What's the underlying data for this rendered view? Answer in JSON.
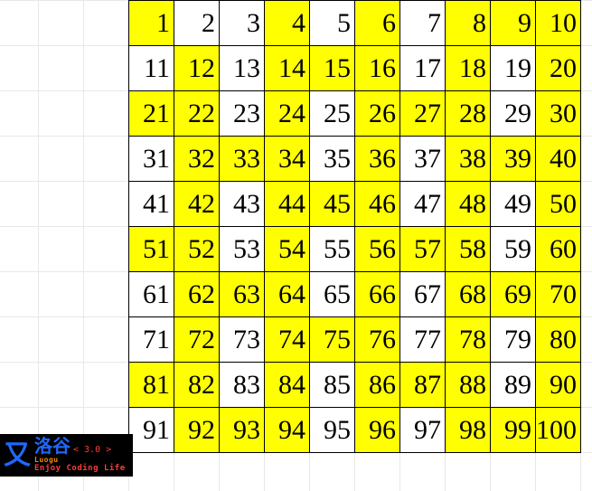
{
  "grid": {
    "cols": 10,
    "rows": 10,
    "cells": [
      [
        {
          "v": 1,
          "h": true
        },
        {
          "v": 2,
          "h": false
        },
        {
          "v": 3,
          "h": false
        },
        {
          "v": 4,
          "h": true
        },
        {
          "v": 5,
          "h": false
        },
        {
          "v": 6,
          "h": true
        },
        {
          "v": 7,
          "h": false
        },
        {
          "v": 8,
          "h": true
        },
        {
          "v": 9,
          "h": true
        },
        {
          "v": 10,
          "h": true
        }
      ],
      [
        {
          "v": 11,
          "h": false
        },
        {
          "v": 12,
          "h": true
        },
        {
          "v": 13,
          "h": false
        },
        {
          "v": 14,
          "h": true
        },
        {
          "v": 15,
          "h": true
        },
        {
          "v": 16,
          "h": true
        },
        {
          "v": 17,
          "h": false
        },
        {
          "v": 18,
          "h": true
        },
        {
          "v": 19,
          "h": false
        },
        {
          "v": 20,
          "h": true
        }
      ],
      [
        {
          "v": 21,
          "h": true
        },
        {
          "v": 22,
          "h": true
        },
        {
          "v": 23,
          "h": false
        },
        {
          "v": 24,
          "h": true
        },
        {
          "v": 25,
          "h": false
        },
        {
          "v": 26,
          "h": true
        },
        {
          "v": 27,
          "h": true
        },
        {
          "v": 28,
          "h": true
        },
        {
          "v": 29,
          "h": false
        },
        {
          "v": 30,
          "h": true
        }
      ],
      [
        {
          "v": 31,
          "h": false
        },
        {
          "v": 32,
          "h": true
        },
        {
          "v": 33,
          "h": true
        },
        {
          "v": 34,
          "h": true
        },
        {
          "v": 35,
          "h": false
        },
        {
          "v": 36,
          "h": true
        },
        {
          "v": 37,
          "h": false
        },
        {
          "v": 38,
          "h": true
        },
        {
          "v": 39,
          "h": true
        },
        {
          "v": 40,
          "h": true
        }
      ],
      [
        {
          "v": 41,
          "h": false
        },
        {
          "v": 42,
          "h": true
        },
        {
          "v": 43,
          "h": false
        },
        {
          "v": 44,
          "h": true
        },
        {
          "v": 45,
          "h": true
        },
        {
          "v": 46,
          "h": true
        },
        {
          "v": 47,
          "h": false
        },
        {
          "v": 48,
          "h": true
        },
        {
          "v": 49,
          "h": false
        },
        {
          "v": 50,
          "h": true
        }
      ],
      [
        {
          "v": 51,
          "h": true
        },
        {
          "v": 52,
          "h": true
        },
        {
          "v": 53,
          "h": false
        },
        {
          "v": 54,
          "h": true
        },
        {
          "v": 55,
          "h": false
        },
        {
          "v": 56,
          "h": true
        },
        {
          "v": 57,
          "h": true
        },
        {
          "v": 58,
          "h": true
        },
        {
          "v": 59,
          "h": false
        },
        {
          "v": 60,
          "h": true
        }
      ],
      [
        {
          "v": 61,
          "h": false
        },
        {
          "v": 62,
          "h": true
        },
        {
          "v": 63,
          "h": true
        },
        {
          "v": 64,
          "h": true
        },
        {
          "v": 65,
          "h": false
        },
        {
          "v": 66,
          "h": true
        },
        {
          "v": 67,
          "h": false
        },
        {
          "v": 68,
          "h": true
        },
        {
          "v": 69,
          "h": true
        },
        {
          "v": 70,
          "h": true
        }
      ],
      [
        {
          "v": 71,
          "h": false
        },
        {
          "v": 72,
          "h": true
        },
        {
          "v": 73,
          "h": false
        },
        {
          "v": 74,
          "h": true
        },
        {
          "v": 75,
          "h": true
        },
        {
          "v": 76,
          "h": true
        },
        {
          "v": 77,
          "h": false
        },
        {
          "v": 78,
          "h": true
        },
        {
          "v": 79,
          "h": false
        },
        {
          "v": 80,
          "h": true
        }
      ],
      [
        {
          "v": 81,
          "h": true
        },
        {
          "v": 82,
          "h": true
        },
        {
          "v": 83,
          "h": false
        },
        {
          "v": 84,
          "h": true
        },
        {
          "v": 85,
          "h": false
        },
        {
          "v": 86,
          "h": true
        },
        {
          "v": 87,
          "h": true
        },
        {
          "v": 88,
          "h": true
        },
        {
          "v": 89,
          "h": false
        },
        {
          "v": 90,
          "h": true
        }
      ],
      [
        {
          "v": 91,
          "h": false
        },
        {
          "v": 92,
          "h": true
        },
        {
          "v": 93,
          "h": true
        },
        {
          "v": 94,
          "h": true
        },
        {
          "v": 95,
          "h": false
        },
        {
          "v": 96,
          "h": true
        },
        {
          "v": 97,
          "h": false
        },
        {
          "v": 98,
          "h": true
        },
        {
          "v": 99,
          "h": true
        },
        {
          "v": 100,
          "h": true
        }
      ]
    ]
  },
  "brand": {
    "cn": "洛谷",
    "version": "< 3.0 >",
    "py": "Luogu",
    "tag": "Enjoy Coding Life"
  }
}
